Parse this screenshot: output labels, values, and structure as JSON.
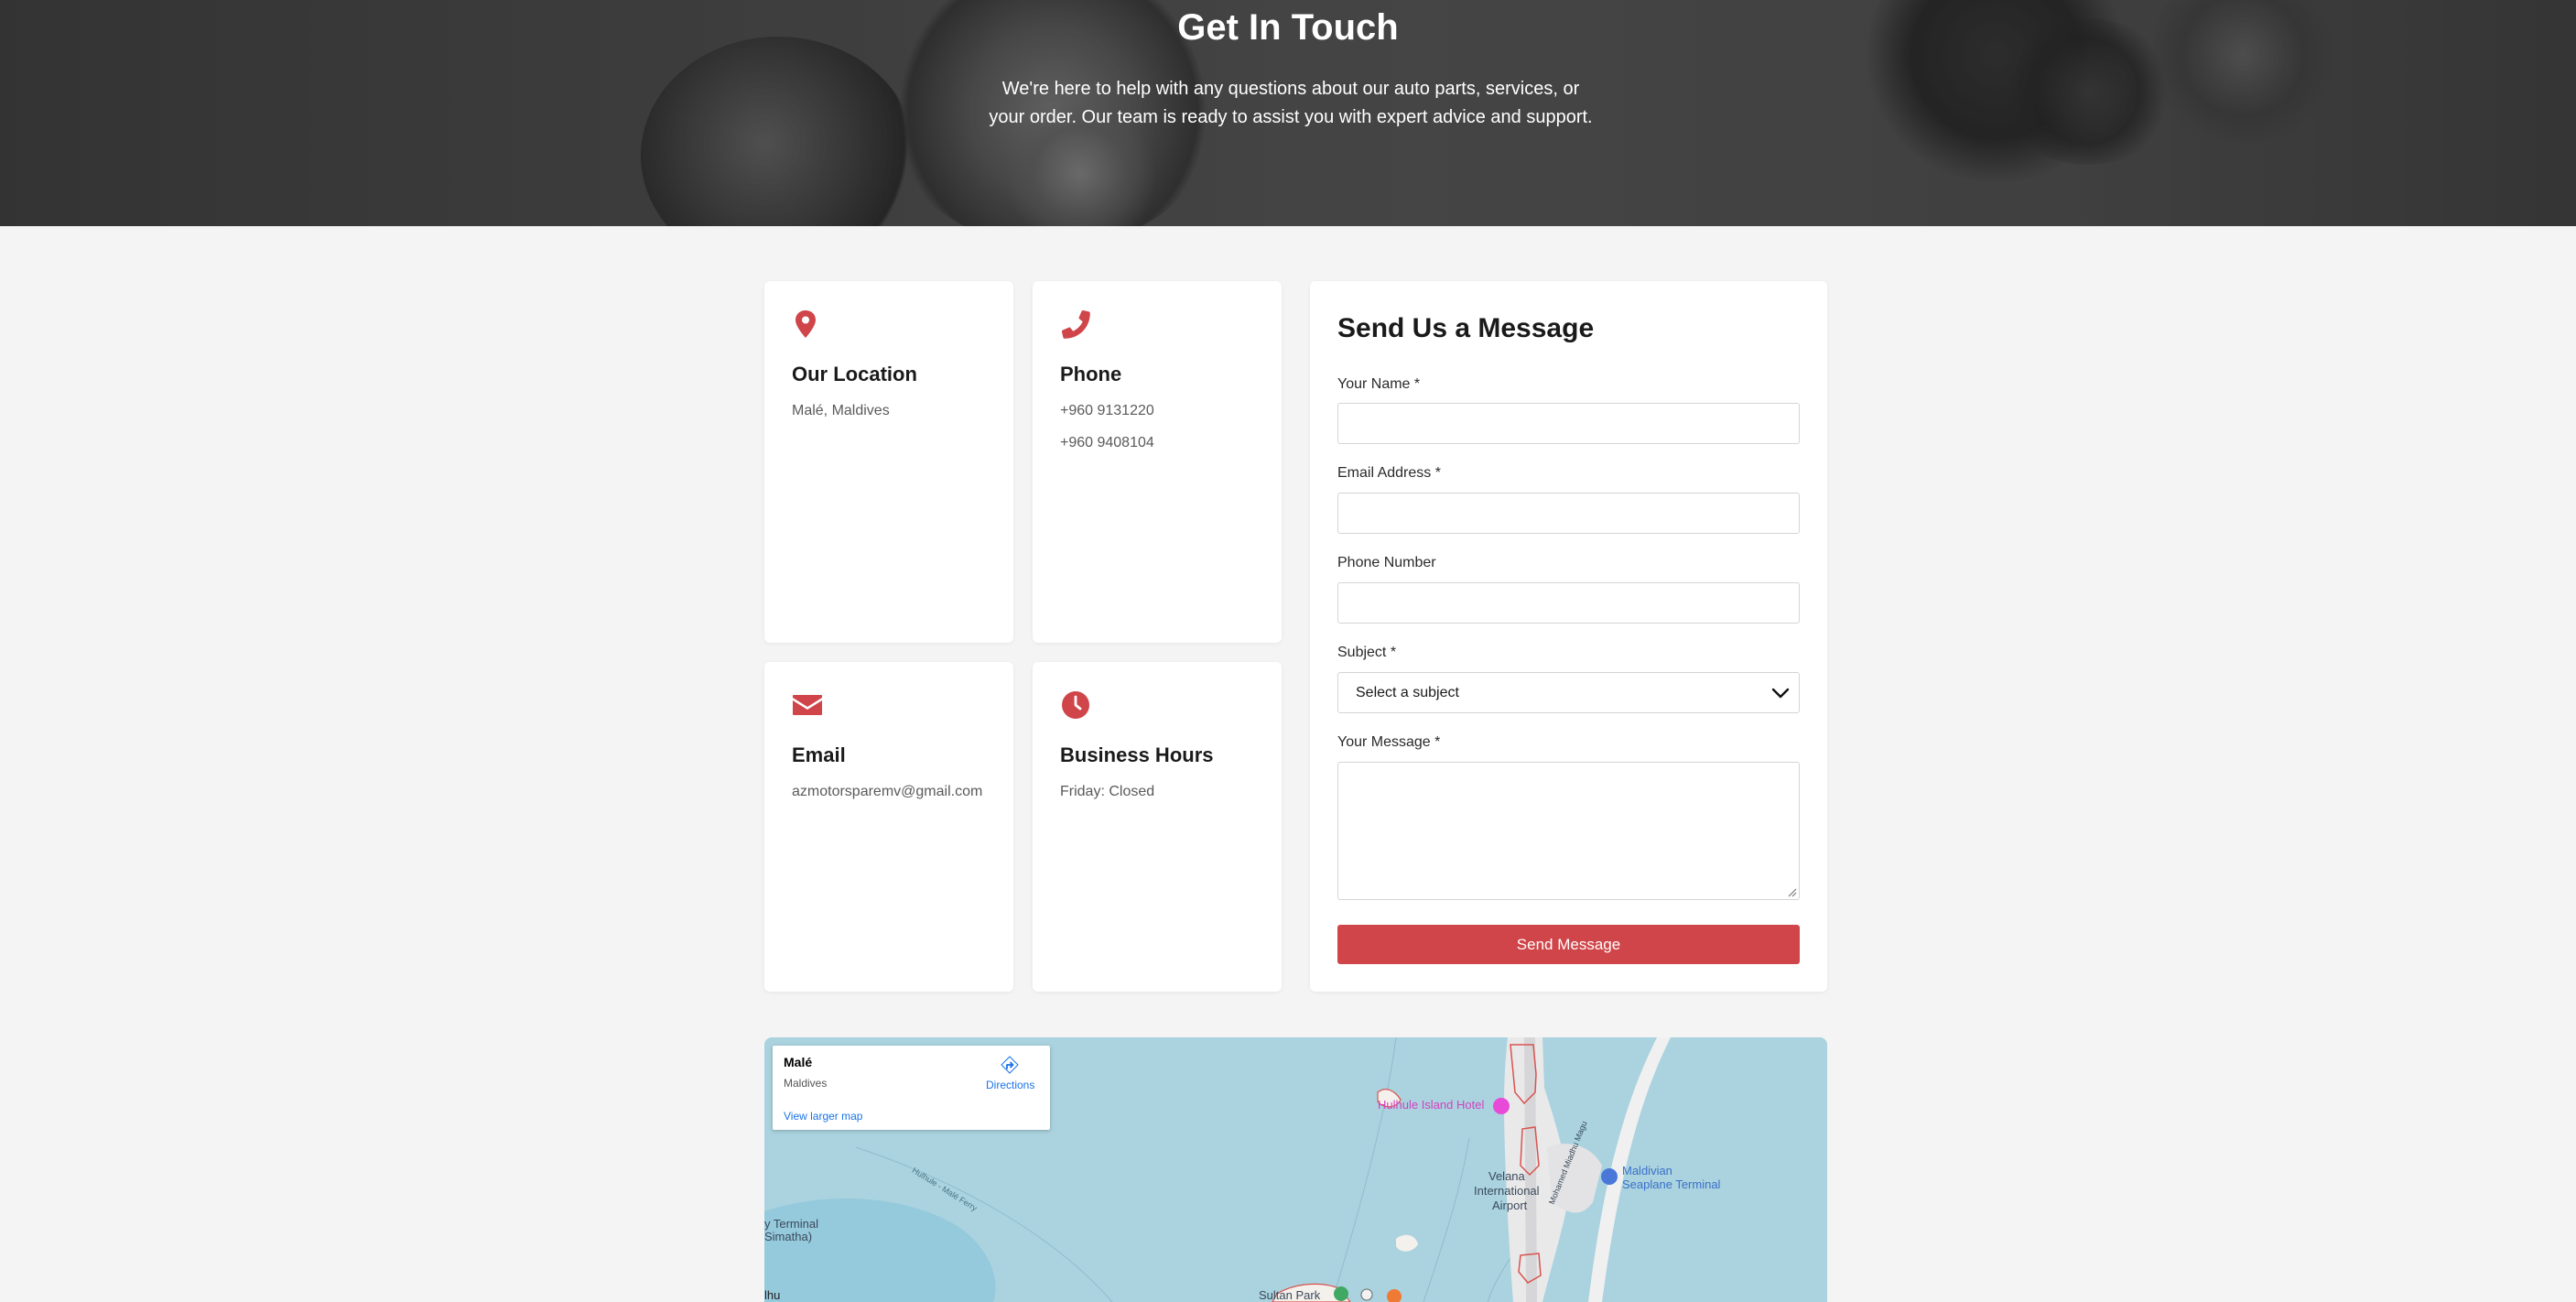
{
  "hero": {
    "title": "Get In Touch",
    "subtitle": "We're here to help with any questions about our auto parts, services, or your order. Our team is ready to assist you with expert advice and support."
  },
  "contact_cards": {
    "location": {
      "icon": "map-marker-icon",
      "title": "Our Location",
      "lines": [
        "Malé, Maldives"
      ]
    },
    "phone": {
      "icon": "phone-icon",
      "title": "Phone",
      "lines": [
        "+960 9131220",
        "+960 9408104"
      ]
    },
    "email": {
      "icon": "envelope-icon",
      "title": "Email",
      "lines": [
        "azmotorsparemv@gmail.com"
      ]
    },
    "hours": {
      "icon": "clock-icon",
      "title": "Business Hours",
      "lines": [
        "Friday: Closed"
      ]
    }
  },
  "form": {
    "title": "Send Us a Message",
    "name_label": "Your Name *",
    "email_label": "Email Address *",
    "phone_label": "Phone Number",
    "subject_label": "Subject *",
    "subject_selected": "Select a subject",
    "message_label": "Your Message *",
    "submit_label": "Send Message"
  },
  "map": {
    "place_title": "Malé",
    "place_subtitle": "Maldives",
    "directions_label": "Directions",
    "larger_map_label": "View larger map",
    "labels": {
      "hotel": "Hulhule Island Hotel",
      "airport_1": "Velana",
      "airport_2": "International",
      "airport_3": "Airport",
      "seaplane_1": "Maldivian",
      "seaplane_2": "Seaplane Terminal",
      "ferry_terminal_1": "y Terminal",
      "ferry_terminal_2": "Simatha)",
      "park": "Sultan Park",
      "edge_town": "lhu",
      "road": "Mohamed Miadhu Magu",
      "ferry_route": "Hulhule - Malé Ferry"
    }
  },
  "colors": {
    "accent": "#cf4549",
    "page_background": "#f4f4f4",
    "map_water": "#aad3df",
    "link": "#1a73e8"
  }
}
